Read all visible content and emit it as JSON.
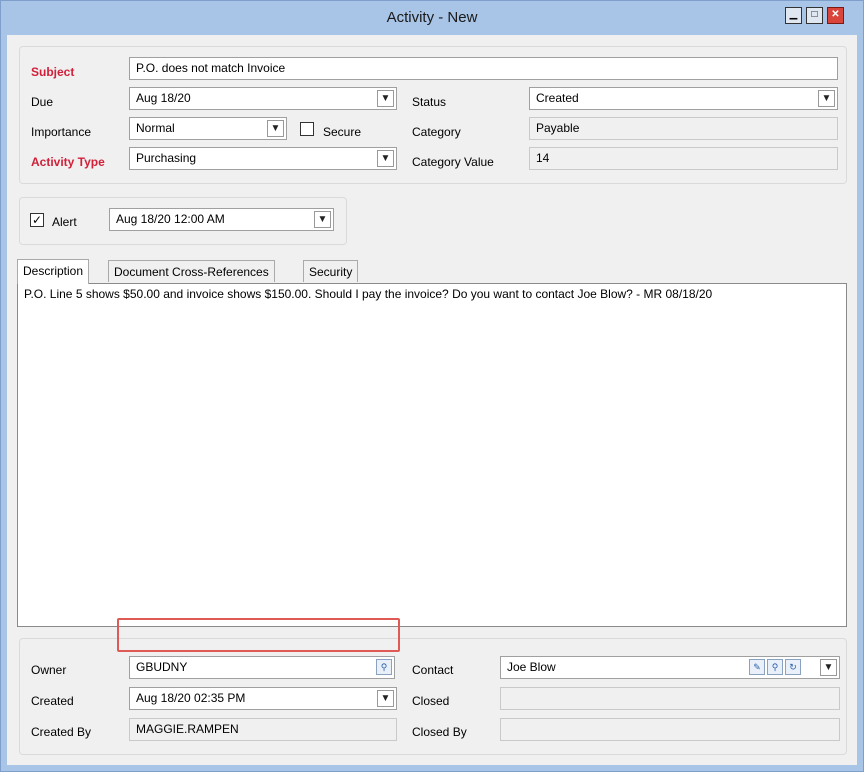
{
  "window": {
    "title": "Activity - New",
    "minimize": "▁",
    "maximize": "□",
    "close": "✕"
  },
  "form": {
    "subject_label": "Subject",
    "subject_value": "P.O. does not match Invoice",
    "due_label": "Due",
    "due_value": "Aug 18/20",
    "status_label": "Status",
    "status_value": "Created",
    "importance_label": "Importance",
    "importance_value": "Normal",
    "secure_label": "Secure",
    "category_label": "Category",
    "category_value": "Payable",
    "activity_type_label": "Activity Type",
    "activity_type_value": "Purchasing",
    "category_value_label": "Category Value",
    "category_value_value": "14"
  },
  "alert": {
    "label": "Alert",
    "checked": true,
    "value": "Aug 18/20 12:00 AM"
  },
  "tabs": [
    {
      "label": "Description",
      "active": true
    },
    {
      "label": "Document Cross-References",
      "active": false
    },
    {
      "label": "Security",
      "active": false
    }
  ],
  "description_text": "P.O. Line 5 shows $50.00 and invoice shows $150.00. Should I pay the invoice? Do you want to contact Joe Blow? - MR 08/18/20",
  "footer": {
    "owner_label": "Owner",
    "owner_value": "GBUDNY",
    "contact_label": "Contact",
    "contact_value": "Joe Blow",
    "created_label": "Created",
    "created_value": "Aug 18/20 02:35 PM",
    "closed_label": "Closed",
    "closed_value": "",
    "created_by_label": "Created By",
    "created_by_value": "MAGGIE.RAMPEN",
    "closed_by_label": "Closed By",
    "closed_by_value": ""
  },
  "colors": {
    "required_label": "#d0203a",
    "highlight": "#e05a55",
    "title_bar": "#a8c4e6"
  },
  "icons": {
    "dropdown": "chevron-down-icon",
    "lookup": "magnifier-icon",
    "new_contact": "new-icon",
    "refresh": "refresh-icon"
  }
}
